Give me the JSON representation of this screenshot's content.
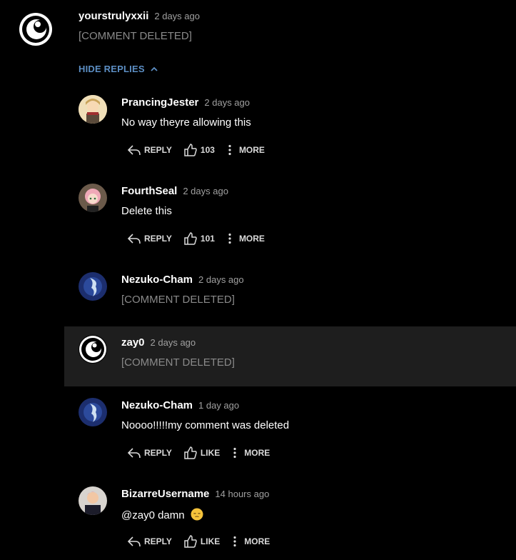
{
  "top_comment": {
    "username": "yourstrulyxxii",
    "time": "2 days ago",
    "text": "[COMMENT DELETED]"
  },
  "hide_replies": {
    "label": "HIDE REPLIES"
  },
  "replies": [
    {
      "username": "PrancingJester",
      "time": "2 days ago",
      "text": "No way theyre allowing this",
      "reply_label": "REPLY",
      "like_label": "103",
      "more_label": "MORE"
    },
    {
      "username": "FourthSeal",
      "time": "2 days ago",
      "text": "Delete this",
      "reply_label": "REPLY",
      "like_label": "101",
      "more_label": "MORE"
    },
    {
      "username": "Nezuko-Cham",
      "time": "2 days ago",
      "text": "[COMMENT DELETED]"
    },
    {
      "username": "zay0",
      "time": "2 days ago",
      "text": "[COMMENT DELETED]"
    },
    {
      "username": "Nezuko-Cham",
      "time": "1 day ago",
      "text": "Noooo!!!!!my comment was deleted",
      "reply_label": "REPLY",
      "like_label": "LIKE",
      "more_label": "MORE"
    },
    {
      "username": "BizarreUsername",
      "time": "14 hours ago",
      "text": "@zay0 damn",
      "emoji": "😔",
      "reply_label": "REPLY",
      "like_label": "LIKE",
      "more_label": "MORE"
    }
  ],
  "colors": {
    "background": "#000000",
    "highlight": "#1e1e1e",
    "link_blue": "#5c8ec3",
    "deleted_gray": "#8a8a8a",
    "time_gray": "#a0a0a0"
  }
}
